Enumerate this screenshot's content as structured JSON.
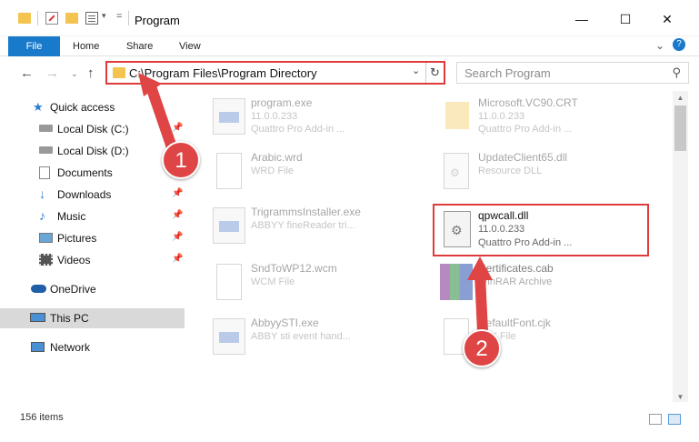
{
  "window": {
    "title": "Program",
    "minimize": "—",
    "maximize": "☐",
    "close": "✕"
  },
  "ribbon": {
    "tabs": [
      "File",
      "Home",
      "Share",
      "View"
    ],
    "expand": "⌄",
    "help": "?"
  },
  "nav_buttons": {
    "back": "←",
    "forward": "→",
    "up": "↑"
  },
  "address": {
    "path": "C:\\Program Files\\Program Directory",
    "dropdown": "⌄",
    "refresh": "↻"
  },
  "search": {
    "placeholder": "Search Program",
    "icon": "⚲"
  },
  "sidebar": {
    "items": [
      {
        "label": "Quick access",
        "icon": "star-icon"
      },
      {
        "label": "Local Disk (C:)",
        "icon": "drive-icon",
        "pinned": true
      },
      {
        "label": "Local Disk (D:)",
        "icon": "drive-icon"
      },
      {
        "label": "Documents",
        "icon": "documents-icon",
        "pinned": true
      },
      {
        "label": "Downloads",
        "icon": "download-icon",
        "pinned": true
      },
      {
        "label": "Music",
        "icon": "music-icon",
        "pinned": true
      },
      {
        "label": "Pictures",
        "icon": "pictures-icon",
        "pinned": true
      },
      {
        "label": "Videos",
        "icon": "videos-icon",
        "pinned": true
      },
      {
        "label": "OneDrive",
        "icon": "cloud-icon"
      },
      {
        "label": "This PC",
        "icon": "pc-icon",
        "selected": true
      },
      {
        "label": "Network",
        "icon": "network-icon"
      }
    ]
  },
  "files": [
    {
      "name": "program.exe",
      "line1": "11.0.0.233",
      "line2": "Quattro Pro Add-in ...",
      "icon": "exe-icon"
    },
    {
      "name": "Microsoft.VC90.CRT",
      "line1": "11.0.0.233",
      "line2": "Quattro Pro Add-in ...",
      "icon": "folder-icon"
    },
    {
      "name": "Arabic.wrd",
      "line1": "WRD File",
      "line2": "",
      "icon": "file-icon"
    },
    {
      "name": "UpdateClient65.dll",
      "line1": "Resource DLL",
      "line2": "",
      "icon": "dll-icon"
    },
    {
      "name": "TrigrammsInstaller.exe",
      "line1": "ABBYY fineReader tri...",
      "line2": "",
      "icon": "exe-icon"
    },
    {
      "name": "qpwcall.dll",
      "line1": "11.0.0.233",
      "line2": "Quattro Pro Add-in ...",
      "icon": "dll-icon",
      "highlighted": true
    },
    {
      "name": "SndToWP12.wcm",
      "line1": "WCM File",
      "line2": "",
      "icon": "file-icon"
    },
    {
      "name": "Certificates.cab",
      "line1": "WinRAR Archive",
      "line2": "",
      "icon": "archive-icon"
    },
    {
      "name": "AbbyySTI.exe",
      "line1": "ABBY sti event hand...",
      "line2": "",
      "icon": "exe-icon"
    },
    {
      "name": "DefaultFont.cjk",
      "line1": "CJK File",
      "line2": "",
      "icon": "file-icon"
    }
  ],
  "status": {
    "count": "156 items"
  },
  "callouts": {
    "one": "1",
    "two": "2"
  },
  "colors": {
    "accent": "#1979ca",
    "highlight": "#e03b3b",
    "folder": "#f3c44f"
  }
}
